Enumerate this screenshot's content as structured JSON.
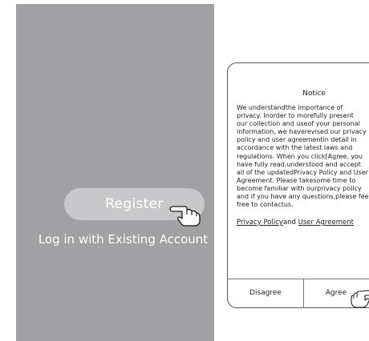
{
  "welcome_screen": {
    "register_label": "Register",
    "login_label": "Log in with Existing Account"
  },
  "notice_dialog": {
    "title": "Notice",
    "body_lines": [
      "We understandthe importance of",
      "privacy. Inorder to morefully present",
      "our collection and useof your personal",
      "information, we haverevised our privacy",
      "policy and user agreementin detail in",
      "accordance with the latest laws and",
      "regulations. When you click[Agree, you",
      "have fully read,understood and accept",
      "all of the updatedPrivacy Policy and User",
      "Agreement. Please takesome time to",
      "become familiar with ourprivacy policy",
      "and if you have any questions,please feel",
      "free to contactus."
    ],
    "privacy_policy_link": "Privacy Policy",
    "and_text": "and",
    "user_agreement_link": "User Agreement",
    "disagree_label": "Disagree",
    "agree_label": "Agree"
  },
  "colors": {
    "screen_background": "#a1a1a4",
    "register_button": "#c8c8ca",
    "text_on_screen": "#ffffff"
  },
  "icons": [
    "pointing-hand-icon"
  ]
}
